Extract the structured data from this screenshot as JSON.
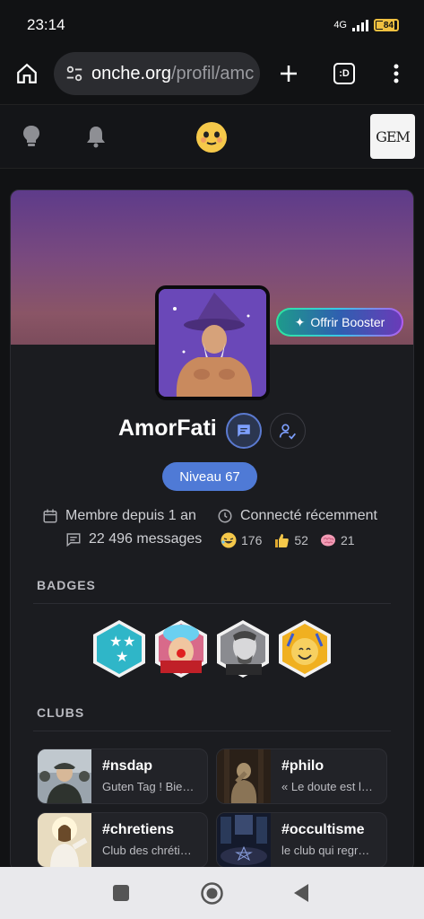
{
  "status": {
    "time": "23:14",
    "network": "4G",
    "battery": "84"
  },
  "browser": {
    "url_host": "onche.org",
    "url_path": "/profil/amc",
    "tab_label": ":D"
  },
  "sitenav": {
    "logo_text": "GEM"
  },
  "profile": {
    "booster_label": "Offrir Booster",
    "username": "AmorFati",
    "level": "Niveau 67",
    "member_since": "Membre depuis 1 an",
    "last_seen": "Connecté récemment",
    "messages": "22 496 messages",
    "reactions": {
      "laugh": "176",
      "thumbs": "52",
      "brain": "21"
    }
  },
  "badges": {
    "title": "BADGES",
    "items": [
      "stars-badge",
      "clown-badge",
      "gigachad-badge",
      "celebrate-badge"
    ]
  },
  "clubs": {
    "title": "CLUBS",
    "items": [
      {
        "name": "#nsdap",
        "desc": "Guten Tag ! Bie…"
      },
      {
        "name": "#philo",
        "desc": "« Le doute est l…"
      },
      {
        "name": "#chretiens",
        "desc": "Club des chréti…"
      },
      {
        "name": "#occultisme",
        "desc": "le club qui regr…"
      }
    ]
  }
}
